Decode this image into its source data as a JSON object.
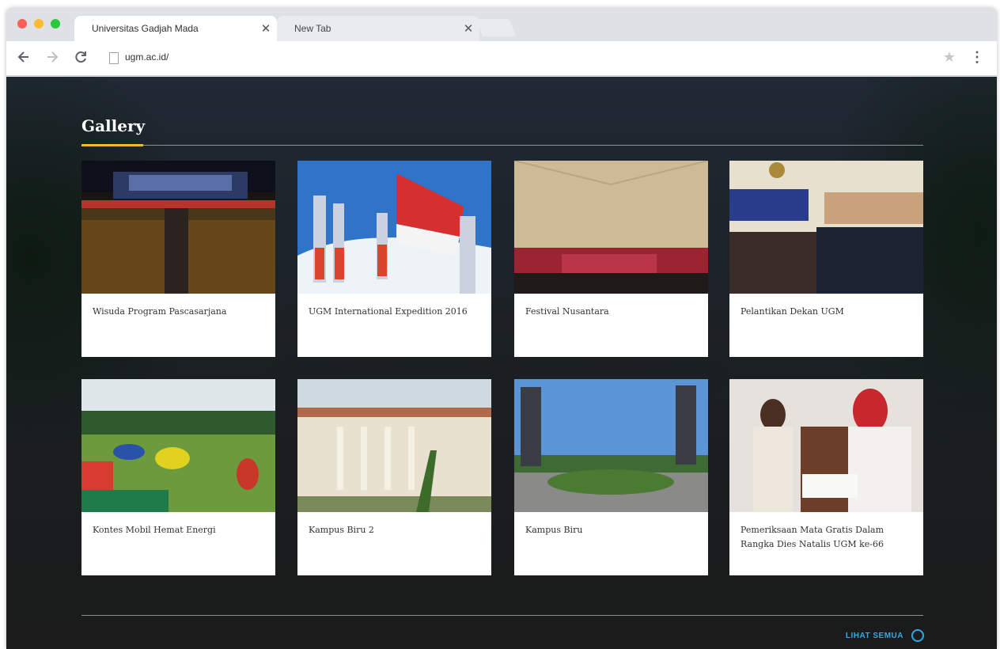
{
  "browser": {
    "tabs": [
      {
        "title": "Universitas Gadjah Mada",
        "close": "✕"
      },
      {
        "title": "New Tab",
        "close": "✕"
      }
    ],
    "url": "ugm.ac.id/",
    "icons": {
      "back": "arrow-left-icon",
      "forward": "arrow-right-icon",
      "reload": "reload-icon",
      "star": "star-icon",
      "menu": "kebab-menu-icon"
    }
  },
  "gallery": {
    "title": "Gallery",
    "accent_color": "#f0b72f",
    "items": [
      {
        "caption": "Wisuda Program Pascasarjana"
      },
      {
        "caption": "UGM International Expedition 2016"
      },
      {
        "caption": "Festival Nusantara"
      },
      {
        "caption": "Pelantikan Dekan UGM"
      },
      {
        "caption": "Kontes Mobil Hemat Energi"
      },
      {
        "caption": "Kampus Biru 2"
      },
      {
        "caption": "Kampus Biru"
      },
      {
        "caption": "Pemeriksaan Mata Gratis Dalam Rangka Dies Natalis UGM ke-66"
      }
    ],
    "see_all_label": "LIHAT SEMUA",
    "link_color": "#3aa6e0"
  }
}
